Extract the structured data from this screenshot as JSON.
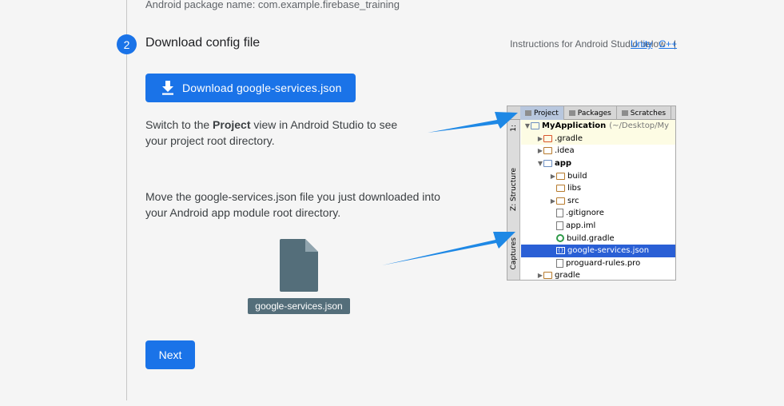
{
  "header": {
    "package_line": "Android package name: com.example.firebase_training"
  },
  "step": {
    "number": "2",
    "title": "Download config file"
  },
  "instructions": {
    "text": "Instructions for Android Studio below",
    "separator": "|",
    "links": [
      "Unity",
      "C++"
    ]
  },
  "download_button": {
    "label": "Download google-services.json",
    "icon": "download-icon"
  },
  "paragraphs": {
    "p1_before": "Switch to the ",
    "p1_bold": "Project",
    "p1_after": " view in Android Studio to see your project root directory.",
    "p2": "Move the google-services.json file you just downloaded into your Android app module root directory."
  },
  "file_badge": {
    "label": "google-services.json",
    "icon": "document-file-icon"
  },
  "next_button": {
    "label": "Next"
  },
  "studio": {
    "tabs": [
      "Project",
      "Packages",
      "Scratches"
    ],
    "side_labels": [
      "1:",
      "Z: Structure",
      "Captures"
    ],
    "tree": [
      {
        "label": "MyApplication",
        "suffix": "(~/Desktop/My",
        "indent": 0,
        "expanded": true,
        "icon": "module-folder-icon",
        "bold": true,
        "highlight": true
      },
      {
        "label": ".gradle",
        "indent": 1,
        "expanded": false,
        "icon": "folder-icon",
        "highlight": true
      },
      {
        "label": ".idea",
        "indent": 1,
        "expanded": false,
        "icon": "folder-icon"
      },
      {
        "label": "app",
        "indent": 1,
        "expanded": true,
        "icon": "module-folder-icon",
        "bold": true
      },
      {
        "label": "build",
        "indent": 2,
        "expanded": false,
        "icon": "folder-icon"
      },
      {
        "label": "libs",
        "indent": 2,
        "icon": "folder-icon"
      },
      {
        "label": "src",
        "indent": 2,
        "expanded": false,
        "icon": "folder-icon"
      },
      {
        "label": ".gitignore",
        "indent": 2,
        "icon": "file-icon"
      },
      {
        "label": "app.iml",
        "indent": 2,
        "icon": "file-icon"
      },
      {
        "label": "build.gradle",
        "indent": 2,
        "icon": "gradle-icon"
      },
      {
        "label": "google-services.json",
        "indent": 2,
        "icon": "json-file-icon",
        "selected": true
      },
      {
        "label": "proguard-rules.pro",
        "indent": 2,
        "icon": "file-icon"
      },
      {
        "label": "gradle",
        "indent": 1,
        "expanded": false,
        "icon": "folder-icon"
      }
    ]
  },
  "colors": {
    "accent": "#1a73e8",
    "arrow": "#1e88e5",
    "selection": "#2a5fd5",
    "file_badge": "#546e7a"
  }
}
